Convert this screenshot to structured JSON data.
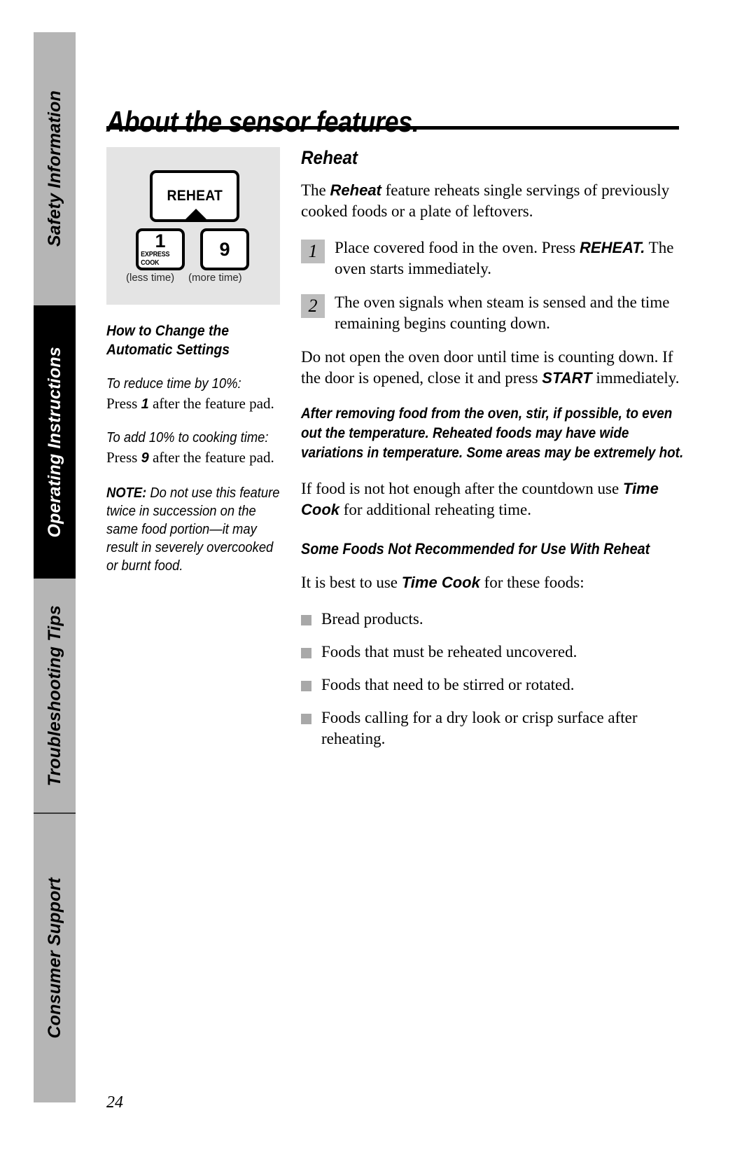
{
  "sidebar": {
    "tabs": [
      {
        "label": "Safety Information",
        "state": "inactive"
      },
      {
        "label": "Operating Instructions",
        "state": "active"
      },
      {
        "label": "Troubleshooting Tips",
        "state": "inactive"
      },
      {
        "label": "Consumer Support",
        "state": "inactive"
      }
    ]
  },
  "page": {
    "title": "About the sensor features.",
    "number": "24"
  },
  "keypad": {
    "reheat_key_label": "REHEAT",
    "key_one_digit": "1",
    "key_one_sub": "EXPRESS COOK",
    "key_nine_digit": "9",
    "caption_less": "(less time)",
    "caption_more": "(more time)"
  },
  "left_column": {
    "heading": "How to Change the Automatic Settings",
    "reduce_label": "To reduce time by 10%:",
    "reduce_text_pre": "Press ",
    "reduce_text_key": "1",
    "reduce_text_post": " after the feature pad.",
    "add_label": "To add 10% to cooking time:",
    "add_text_pre": "Press ",
    "add_text_key": "9",
    "add_text_post": " after the feature pad.",
    "note_label": "NOTE:",
    "note_text": " Do not use this feature twice in succession on the same food portion—it may result in severely overcooked or burnt food."
  },
  "right_column": {
    "heading": "Reheat",
    "intro_pre": "The ",
    "intro_bold": "Reheat",
    "intro_post": "  feature reheats single servings of previously cooked foods or a plate of leftovers.",
    "steps": [
      {
        "number": "1",
        "text_pre": "Place covered food in the oven. Press ",
        "text_bold": "REHEAT.",
        "text_post": " The oven starts immediately."
      },
      {
        "number": "2",
        "text_pre": "The oven signals when steam is sensed and the time remaining begins counting down.",
        "text_bold": "",
        "text_post": ""
      }
    ],
    "door_warning_pre": "Do not open the oven door until time is counting down. If the door is opened, close it and press ",
    "door_warning_bold": "START",
    "door_warning_post": " immediately.",
    "stir_warning": "After removing food from the oven, stir, if possible, to even out the temperature. Reheated foods may have wide variations in temperature. Some areas may be extremely hot.",
    "not_hot_pre": "If food is not hot enough after the countdown use ",
    "not_hot_bold": "Time Cook",
    "not_hot_post": " for additional reheating time.",
    "foods_heading": "Some Foods Not Recommended for Use With Reheat",
    "foods_intro_pre": "It is best to use ",
    "foods_intro_bold": "Time Cook",
    "foods_intro_post": " for these foods:",
    "foods_list": [
      "Bread products.",
      "Foods that must be reheated uncovered.",
      "Foods that need to be stirred or rotated.",
      "Foods calling for a dry look or crisp surface after reheating."
    ]
  },
  "colors": {
    "tab_gray": "#b5b5b5",
    "tab_active": "#000000",
    "panel_gray": "#e4e4e4",
    "step_num_gray": "#bdbdbd",
    "bullet_gray": "#a8a8a8"
  }
}
